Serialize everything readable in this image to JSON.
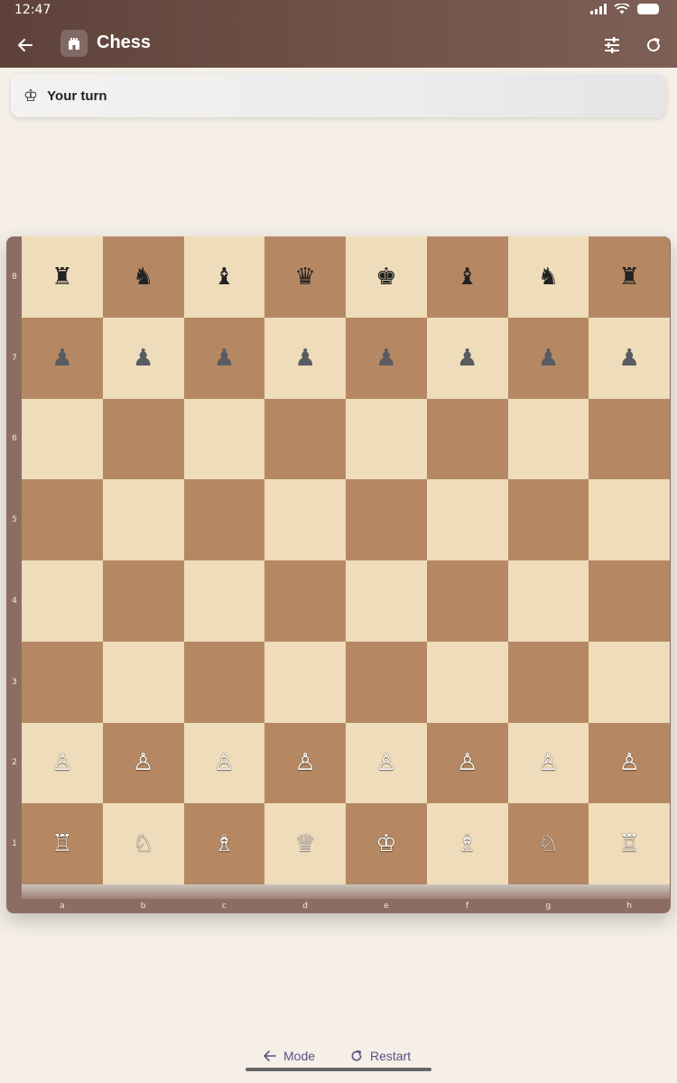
{
  "status_bar": {
    "time": "12:47"
  },
  "app_bar": {
    "title": "Chess",
    "back_icon": "back-arrow-icon",
    "settings_icon": "tune-icon",
    "refresh_icon": "refresh-icon"
  },
  "turn": {
    "text": "Your turn",
    "icon": "king-icon"
  },
  "board": {
    "files": [
      "a",
      "b",
      "c",
      "d",
      "e",
      "f",
      "g",
      "h"
    ],
    "ranks": [
      "8",
      "7",
      "6",
      "5",
      "4",
      "3",
      "2",
      "1"
    ],
    "rows": [
      [
        "♜",
        "♞",
        "♝",
        "♛",
        "♚",
        "♝",
        "♞",
        "♜"
      ],
      [
        "♟",
        "♟",
        "♟",
        "♟",
        "♟",
        "♟",
        "♟",
        "♟"
      ],
      [
        "",
        "",
        "",
        "",
        "",
        "",
        "",
        ""
      ],
      [
        "",
        "",
        "",
        "",
        "",
        "",
        "",
        ""
      ],
      [
        "",
        "",
        "",
        "",
        "",
        "",
        "",
        ""
      ],
      [
        "",
        "",
        "",
        "",
        "",
        "",
        "",
        ""
      ],
      [
        "♙",
        "♙",
        "♙",
        "♙",
        "♙",
        "♙",
        "♙",
        "♙"
      ],
      [
        "♖",
        "♘",
        "♗",
        "♕",
        "♔",
        "♗",
        "♘",
        "♖"
      ]
    ],
    "light_color": "#eedcba",
    "dark_color": "#b58863"
  },
  "bottom": {
    "mode_label": "Mode",
    "restart_label": "Restart"
  }
}
